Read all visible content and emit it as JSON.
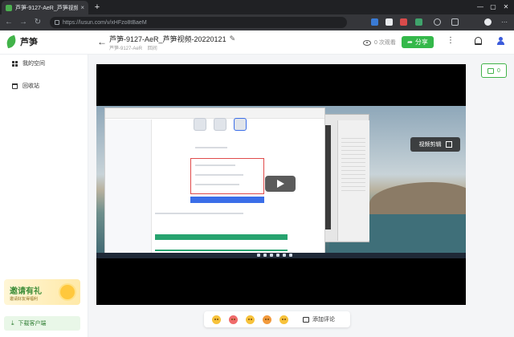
{
  "browser": {
    "tab_title": "芦笋-9127-AeR_芦笋视频-2022",
    "tab_close": "×",
    "new_tab": "+",
    "url": "https://lusun.com/v/xHFzo8tBaeM",
    "window_controls": [
      "—",
      "▢",
      "✕"
    ]
  },
  "app": {
    "logo_text": "芦笋",
    "back": "←",
    "video_title": "芦笋-9127-AeR_芦笋视频-20220121",
    "edit_icon": "✎",
    "owner": "芦笋-9127-AeR",
    "owner_tag": "回间",
    "views": "0 次观看",
    "share_label": "分享",
    "more": "⋮"
  },
  "sidebar": {
    "items": [
      {
        "label": "我的空间",
        "icon": "grid-icon"
      },
      {
        "label": "回收站",
        "icon": "trash-icon"
      }
    ],
    "promo_title": "邀请有礼",
    "promo_sub": "邀请好友得福利",
    "download_label": "下载客户端"
  },
  "player": {
    "edit_label": "视频剪辑",
    "play_icon": "play-icon"
  },
  "comments": {
    "count": "0",
    "add_label": "添加评论"
  },
  "reactions": [
    "thumbs-up-icon",
    "heart-eyes-icon",
    "clap-icon",
    "party-icon",
    "surprised-icon"
  ]
}
